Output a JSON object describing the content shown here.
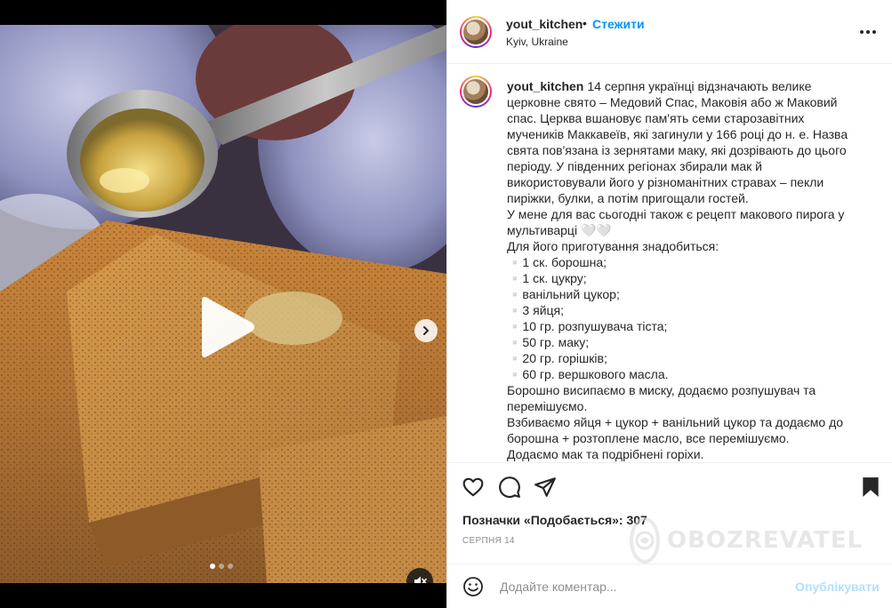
{
  "media": {
    "carousel_total": 3,
    "carousel_active": 1
  },
  "header": {
    "username": "yout_kitchen",
    "separator": "•",
    "follow_label": "Стежити",
    "location": "Kyiv, Ukraine"
  },
  "caption": {
    "username": "yout_kitchen",
    "text": "14 серпня українці відзначають велике церковне свято – Медовий Спас, Маковія або ж Маковий спас. Церква вшановує пам'ять семи старозавітних мучеників Маккавеїв, які загинули у 166 році до н. е. Назва свята пов'язана із зернятами маку, які дозрівають до цього періоду. У південних регіонах збирали мак й використовували його у різноманітних стравах – пекли пиріжки, булки, а потім пригощали гостей.\nУ мене для вас сьогодні також є рецепт макового пирога у мультиварці 🤍🤍\nДля його приготування знадобиться:\n▫️1 ск. борошна;\n▫️1 ск. цукру;\n▫️ванільний цукор;\n▫️3 яйця;\n▫️10 гр. розпушувача тіста;\n▫️50 гр. маку;\n▫️20 гр. горішків;\n▫️60 гр. вершкового масла.\nБорошно висипаємо в миску, додаємо розпушувач та перемішуємо.\nВзбиваємо яйця + цукор + ванільний цукор та додаємо до борошна + розтоплене масло, все перемішуємо.\nДодаємо мак та подрібнені горіхи."
  },
  "likes": {
    "text": "Позначки «Подобається»: 307"
  },
  "date": "Серпня 14",
  "comment": {
    "placeholder": "Додайте коментар...",
    "post_label": "Опублікувати"
  },
  "watermark": {
    "text": "OBOZREVATEL"
  },
  "icons": {
    "like": "heart-icon",
    "comment": "comment-icon",
    "share": "paper-plane-icon",
    "save": "bookmark-icon",
    "emoji": "smiley-icon",
    "more": "more-dots-icon",
    "play": "play-icon",
    "next": "chevron-right-icon",
    "mute": "mute-icon"
  },
  "colors": {
    "link_blue": "#0095f6",
    "post_disabled": "#b2dffc",
    "secondary_text": "#8e8e8e"
  }
}
